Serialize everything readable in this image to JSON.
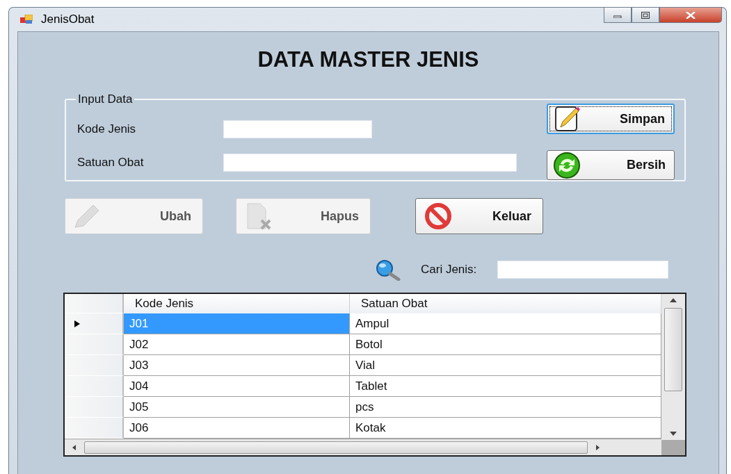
{
  "window": {
    "title": "JenisObat"
  },
  "heading": "DATA MASTER JENIS",
  "input_group": {
    "legend": "Input Data",
    "fields": [
      {
        "label": "Kode Jenis",
        "kind": "short"
      },
      {
        "label": "Satuan Obat",
        "kind": "long"
      }
    ],
    "buttons": [
      {
        "label": "Simpan",
        "kind": "save",
        "focused": true
      },
      {
        "label": "Bersih",
        "kind": "clear",
        "focused": false
      }
    ]
  },
  "actions": [
    {
      "label": "Ubah",
      "kind": "edit",
      "disabled": true
    },
    {
      "label": "Hapus",
      "kind": "delete",
      "disabled": true
    },
    {
      "label": "Keluar",
      "kind": "exit",
      "disabled": false
    }
  ],
  "search": {
    "label": "Cari Jenis:"
  },
  "table": {
    "columns": [
      "Kode Jenis",
      "Satuan Obat"
    ],
    "rows": [
      {
        "cells": [
          "J01",
          "Ampul"
        ],
        "selected": true
      },
      {
        "cells": [
          "J02",
          "Botol"
        ],
        "selected": false
      },
      {
        "cells": [
          "J03",
          "Vial"
        ],
        "selected": false
      },
      {
        "cells": [
          "J04",
          "Tablet"
        ],
        "selected": false
      },
      {
        "cells": [
          "J05",
          "pcs"
        ],
        "selected": false
      },
      {
        "cells": [
          "J06",
          "Kotak"
        ],
        "selected": false
      }
    ]
  }
}
